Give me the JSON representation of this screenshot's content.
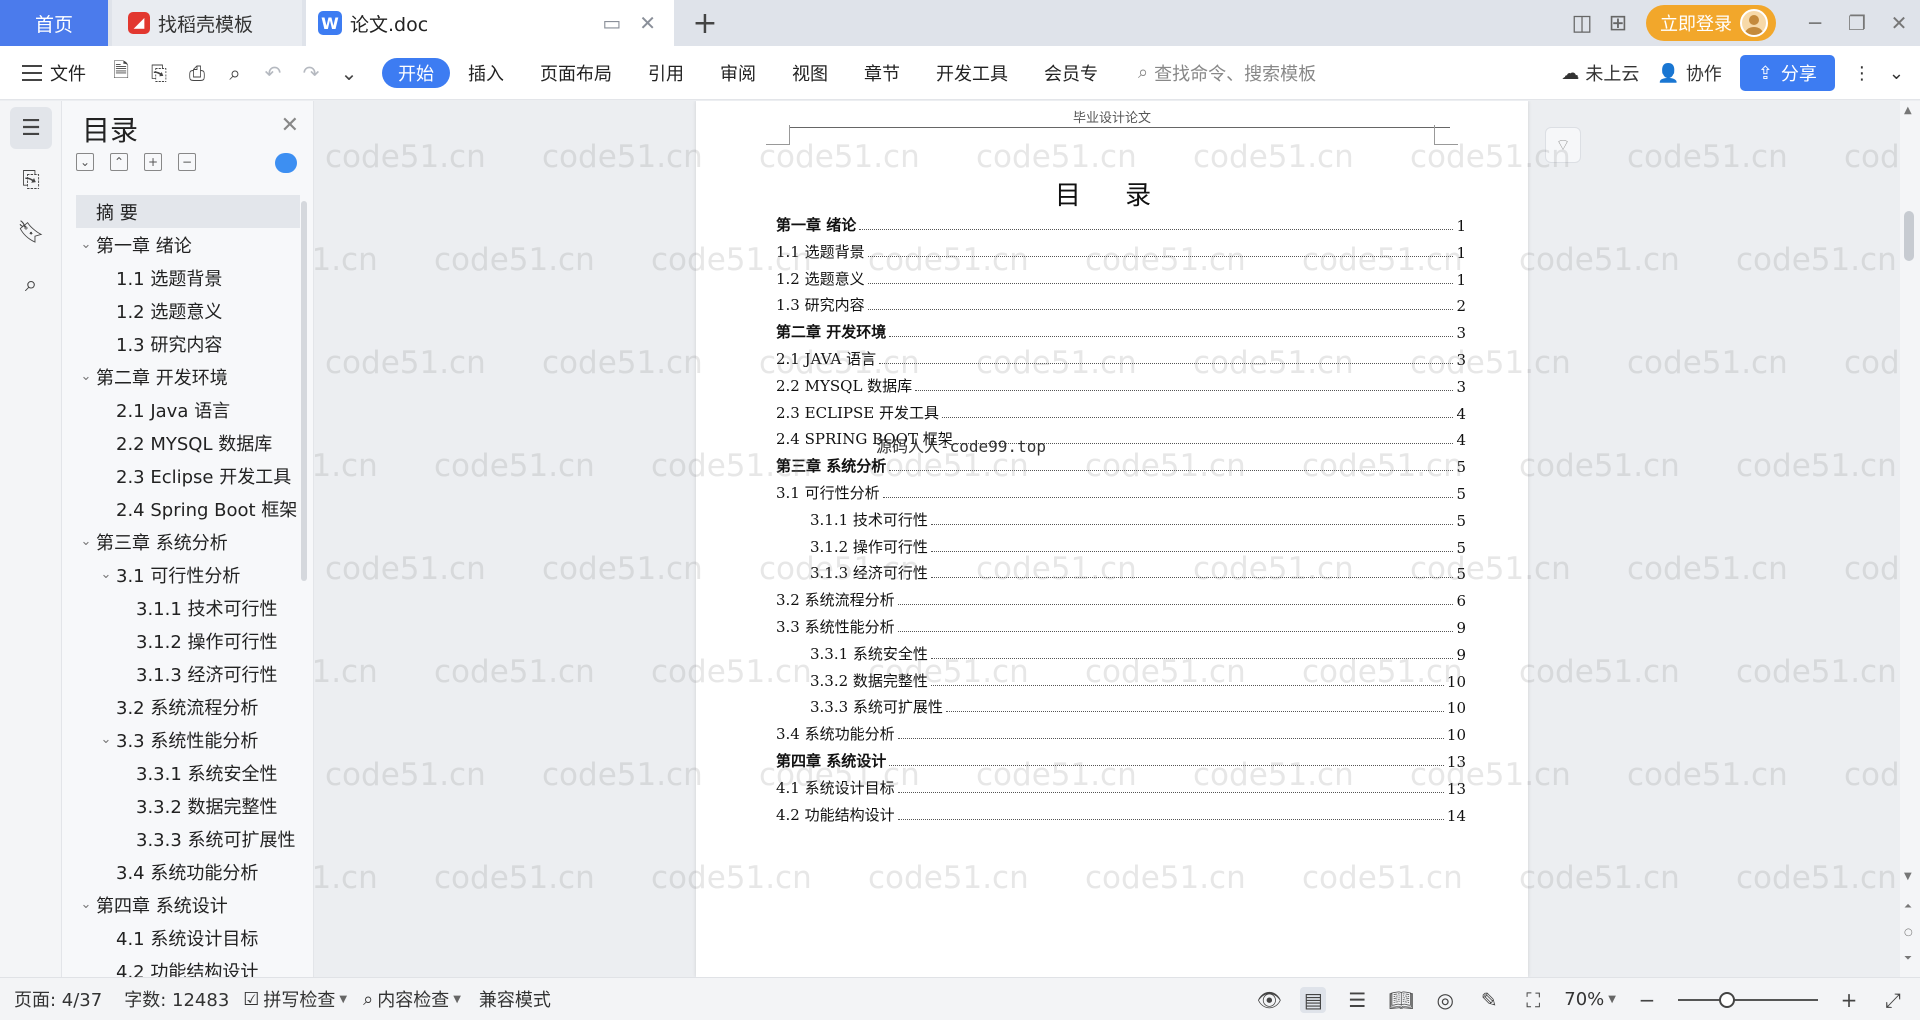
{
  "tabs": {
    "home": "首页",
    "template": "找稻壳模板",
    "document": "论文.doc",
    "new_tab": "+"
  },
  "titlebar": {
    "login": "立即登录"
  },
  "ribbon": {
    "file": "文件",
    "menu": [
      "开始",
      "插入",
      "页面布局",
      "引用",
      "审阅",
      "视图",
      "章节",
      "开发工具",
      "会员专"
    ],
    "search_placeholder": "查找命令、搜索模板",
    "cloud": "未上云",
    "collab": "协作",
    "share": "分享"
  },
  "toc_panel": {
    "title": "目录",
    "items": [
      {
        "label": "摘   要",
        "level": 1,
        "chevron": "",
        "selected": true
      },
      {
        "label": "第一章  绪论",
        "level": 1,
        "chevron": "⌄"
      },
      {
        "label": "1.1  选题背景",
        "level": 2,
        "chevron": ""
      },
      {
        "label": "1.2  选题意义",
        "level": 2,
        "chevron": ""
      },
      {
        "label": "1.3  研究内容",
        "level": 2,
        "chevron": ""
      },
      {
        "label": "第二章  开发环境",
        "level": 1,
        "chevron": "⌄"
      },
      {
        "label": "2.1 Java 语言",
        "level": 2,
        "chevron": ""
      },
      {
        "label": "2.2 MYSQL 数据库",
        "level": 2,
        "chevron": ""
      },
      {
        "label": "2.3 Eclipse 开发工具",
        "level": 2,
        "chevron": ""
      },
      {
        "label": "2.4 Spring Boot 框架",
        "level": 2,
        "chevron": ""
      },
      {
        "label": "第三章  系统分析",
        "level": 1,
        "chevron": "⌄"
      },
      {
        "label": "3.1 可行性分析",
        "level": 2,
        "chevron": "⌄"
      },
      {
        "label": "3.1.1 技术可行性",
        "level": 3,
        "chevron": ""
      },
      {
        "label": "3.1.2 操作可行性",
        "level": 3,
        "chevron": ""
      },
      {
        "label": "3.1.3 经济可行性",
        "level": 3,
        "chevron": ""
      },
      {
        "label": "3.2 系统流程分析",
        "level": 2,
        "chevron": ""
      },
      {
        "label": "3.3 系统性能分析",
        "level": 2,
        "chevron": "⌄"
      },
      {
        "label": "3.3.1 系统安全性",
        "level": 3,
        "chevron": ""
      },
      {
        "label": "3.3.2 数据完整性",
        "level": 3,
        "chevron": ""
      },
      {
        "label": "3.3.3 系统可扩展性",
        "level": 3,
        "chevron": ""
      },
      {
        "label": "3.4 系统功能分析",
        "level": 2,
        "chevron": ""
      },
      {
        "label": "第四章  系统设计",
        "level": 1,
        "chevron": "⌄"
      },
      {
        "label": "4.1  系统设计目标",
        "level": 2,
        "chevron": ""
      },
      {
        "label": "4.2 功能结构设计",
        "level": 2,
        "chevron": ""
      }
    ]
  },
  "document": {
    "header": "毕业设计论文",
    "title": "目 录",
    "center_watermark": "源码人人-code99.top",
    "entries": [
      {
        "text": "第一章  绪论",
        "page": "1",
        "style": "bold",
        "indent": 0
      },
      {
        "text": "1.1  选题背景",
        "page": "1",
        "style": "normal",
        "indent": 0
      },
      {
        "text": "1.2  选题意义",
        "page": "1",
        "style": "normal",
        "indent": 0
      },
      {
        "text": "1.3  研究内容",
        "page": "2",
        "style": "normal",
        "indent": 0
      },
      {
        "text": "第二章  开发环境",
        "page": "3",
        "style": "bold",
        "indent": 0
      },
      {
        "text": "2.1 JAVA 语言",
        "page": "3",
        "style": "normal",
        "indent": 0
      },
      {
        "text": "2.2 MYSQL 数据库",
        "page": "3",
        "style": "normal",
        "indent": 0
      },
      {
        "text": "2.3 ECLIPSE 开发工具",
        "page": "4",
        "style": "normal",
        "indent": 0
      },
      {
        "text": "2.4 SPRING BOOT 框架",
        "page": "4",
        "style": "normal",
        "indent": 0
      },
      {
        "text": "第三章  系统分析",
        "page": "5",
        "style": "bold",
        "indent": 0
      },
      {
        "text": "3.1 可行性分析",
        "page": "5",
        "style": "normal",
        "indent": 0
      },
      {
        "text": "3.1.1 技术可行性",
        "page": "5",
        "style": "normal",
        "indent": 1
      },
      {
        "text": "3.1.2 操作可行性",
        "page": "5",
        "style": "normal",
        "indent": 1
      },
      {
        "text": "3.1.3 经济可行性",
        "page": "5",
        "style": "normal",
        "indent": 1
      },
      {
        "text": "3.2 系统流程分析",
        "page": "6",
        "style": "normal",
        "indent": 0
      },
      {
        "text": "3.3 系统性能分析",
        "page": "9",
        "style": "normal",
        "indent": 0
      },
      {
        "text": "3.3.1 系统安全性",
        "page": "9",
        "style": "normal",
        "indent": 1
      },
      {
        "text": "3.3.2 数据完整性",
        "page": "10",
        "style": "normal",
        "indent": 1
      },
      {
        "text": "3.3.3 系统可扩展性",
        "page": "10",
        "style": "normal",
        "indent": 1
      },
      {
        "text": "3.4 系统功能分析",
        "page": "10",
        "style": "normal",
        "indent": 0
      },
      {
        "text": "第四章  系统设计",
        "page": "13",
        "style": "bold",
        "indent": 0
      },
      {
        "text": "4.1  系统设计目标",
        "page": "13",
        "style": "normal",
        "indent": 0
      },
      {
        "text": "4.2 功能结构设计",
        "page": "14",
        "style": "normal",
        "indent": 0
      }
    ]
  },
  "watermark": "code51.cn",
  "statusbar": {
    "page": "页面: 4/37",
    "words": "字数: 12483",
    "spellcheck": "拼写检查",
    "content_check": "内容检查",
    "compat": "兼容模式",
    "zoom": "70%",
    "zoom_level_percent": 70
  },
  "colors": {
    "accent": "#3d7cf2",
    "login": "#f2a72b",
    "home_tab": "#4b7bec"
  }
}
